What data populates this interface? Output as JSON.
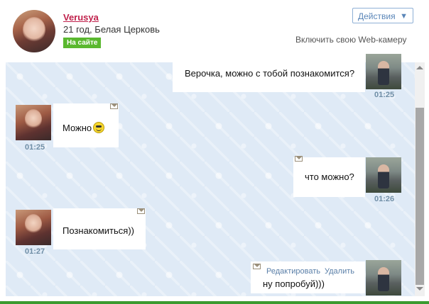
{
  "profile": {
    "name": "Verusya",
    "info": "21 год, Белая Церковь",
    "status": "На сайте"
  },
  "header": {
    "actions_label": "Действия",
    "actions_arrow": "▼",
    "webcam_label": "Включить свою Web-камеру"
  },
  "messages": [
    {
      "from": "him",
      "text": "Верочка, можно с тобой познакомится?",
      "time": "01:25"
    },
    {
      "from": "her",
      "text": "Можно",
      "time": "01:25"
    },
    {
      "from": "him",
      "text": "что можно?",
      "time": "01:26"
    },
    {
      "from": "her",
      "text": "Познакомиться))",
      "time": "01:27"
    },
    {
      "from": "him",
      "text": "ну попробуй)))",
      "time": "",
      "edit_label": "Редактировать",
      "delete_label": "Удалить"
    }
  ],
  "icons": {
    "envelope": "envelope-icon",
    "smiley": "smiley-icon",
    "dropdown": "chevron-down-icon"
  },
  "colors": {
    "username": "#c0224c",
    "online_badge": "#5ab82f",
    "chat_background": "#dfeaf6",
    "time_text": "#6f8ea6",
    "link": "#5a7fa8"
  }
}
